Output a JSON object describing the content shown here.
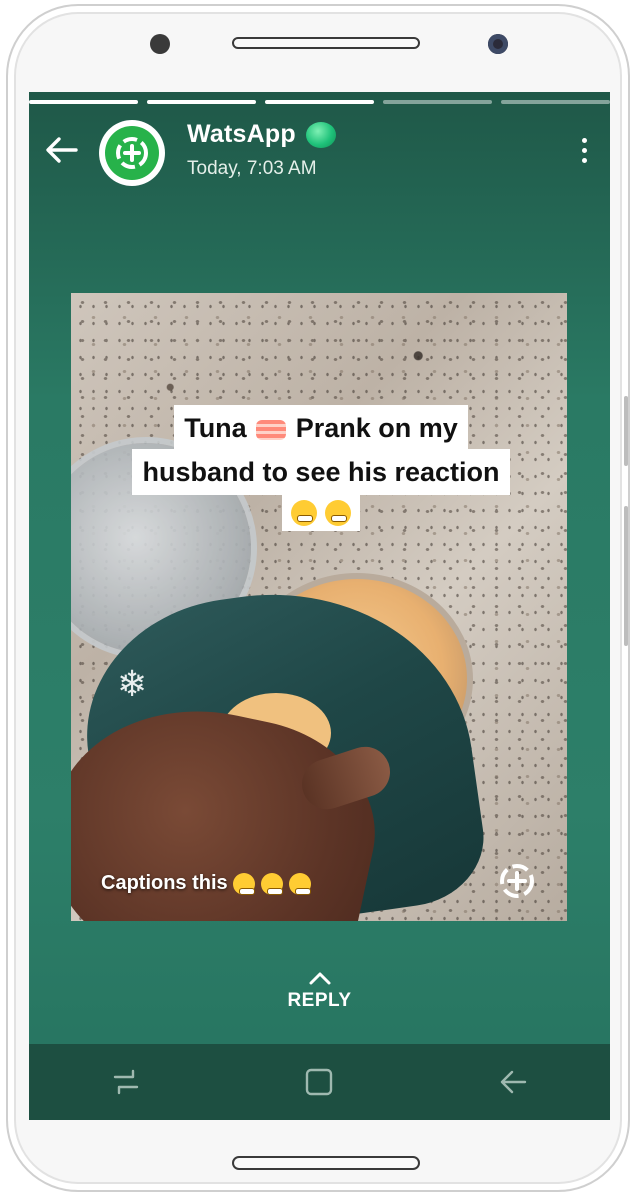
{
  "story": {
    "contact_name": "WatsApp",
    "timestamp": "Today, 7:03 AM",
    "progress": {
      "total_segments": 5,
      "completed_segments": 3,
      "current_segment_fraction": 0.0
    }
  },
  "media": {
    "caption_line1_a": "Tuna",
    "caption_line1_b": "Prank  on my",
    "caption_line2": "husband to see his reaction",
    "bottom_caption": "Captions this",
    "caption_emojis": [
      "sushi",
      "nauseated-face",
      "grimacing-face"
    ],
    "bottom_emojis": [
      "loudly-crying-face",
      "zany-face",
      "grinning-face"
    ]
  },
  "reply": {
    "label": "REPLY"
  },
  "icons": {
    "back": "arrow-left-icon",
    "menu": "more-vertical-icon",
    "avatar": "status-saver-icon",
    "online": "online-dot-icon",
    "watermark": "status-saver-icon",
    "nav_recent": "recent-apps-icon",
    "nav_home": "home-icon",
    "nav_back": "back-icon"
  },
  "colors": {
    "background_top": "#1f5848",
    "background_mid": "#2d7f69",
    "navbar": "#1d4f41",
    "avatar_green": "#27b24a",
    "online_dot": "#1fc27a"
  }
}
